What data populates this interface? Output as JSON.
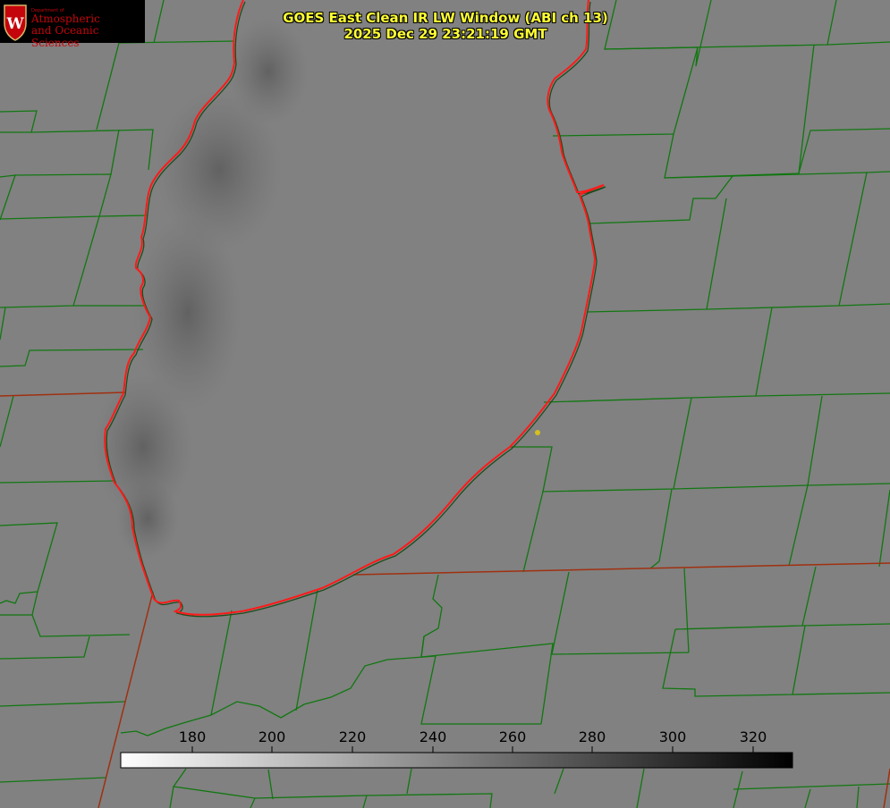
{
  "header": {
    "title_line1": "GOES East Clean IR LW Window (ABI ch 13)",
    "title_line2": "2025 Dec 29 23:21:19 GMT"
  },
  "logo": {
    "department": "Department of",
    "name_line1": "Atmospheric",
    "name_line2": "and Oceanic Sciences",
    "color": "#c5050c"
  },
  "colorbar": {
    "ticks": [
      "180",
      "200",
      "220",
      "240",
      "260",
      "280",
      "300",
      "320"
    ],
    "colormap": "white-to-black (inverted grayscale)"
  },
  "map": {
    "background_color": "#818181",
    "lake_color": "#7a7a7a",
    "county_border_color": "#117711",
    "state_border_color": "#a03010",
    "coastline_color": "#ff1a1a",
    "marker_color": "#d4c020"
  }
}
